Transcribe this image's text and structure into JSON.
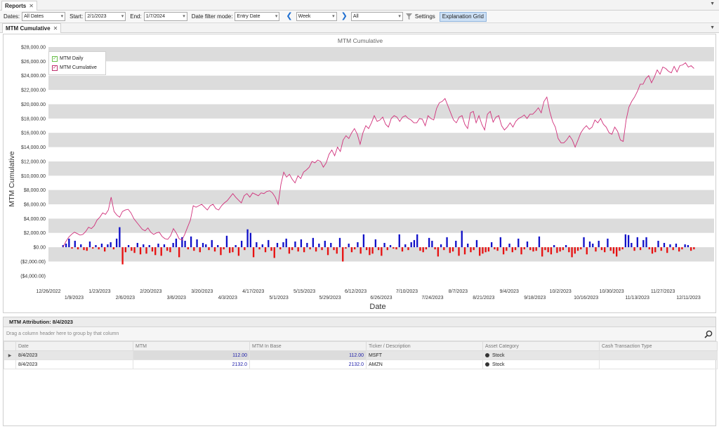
{
  "tabs": {
    "doc_tab": "Reports",
    "close": "✕",
    "sub_tab": "MTM Cumulative"
  },
  "toolbar": {
    "dates_label": "Dates:",
    "dates_value": "All Dates",
    "start_label": "Start:",
    "start_value": "2/1/2023",
    "end_label": "End:",
    "end_value": "1/7/2024",
    "filter_mode_label": "Date filter mode:",
    "filter_mode_value": "Entry Date",
    "period_value": "Week",
    "scope_value": "All",
    "settings_label": "Settings",
    "explanation_grid_label": "Explanation Grid"
  },
  "chart_data": {
    "type": "bar+line",
    "title": "MTM Cumulative",
    "xlabel": "Date",
    "ylabel": "MTM Cumulative",
    "ylim": [
      -5000,
      28000
    ],
    "y_ticks": [
      "$28,000.00",
      "$26,000.00",
      "$24,000.00",
      "$22,000.00",
      "$20,000.00",
      "$18,000.00",
      "$16,000.00",
      "$14,000.00",
      "$12,000.00",
      "$10,000.00",
      "$8,000.00",
      "$6,000.00",
      "$4,000.00",
      "$2,000.00",
      "$0.00",
      "($2,000.00)",
      "($4,000.00)"
    ],
    "x_ticks_upper": [
      "12/26/2022",
      "1/23/2023",
      "2/20/2023",
      "3/20/2023",
      "4/17/2023",
      "5/15/2023",
      "6/12/2023",
      "7/10/2023",
      "8/7/2023",
      "9/4/2023",
      "10/2/2023",
      "10/30/2023",
      "11/27/2023"
    ],
    "x_ticks_lower": [
      "1/9/2023",
      "2/6/2023",
      "3/6/2023",
      "4/3/2023",
      "5/1/2023",
      "5/29/2023",
      "6/26/2023",
      "7/24/2023",
      "8/21/2023",
      "9/18/2023",
      "10/16/2023",
      "11/13/2023",
      "12/11/2023"
    ],
    "x_range": [
      "12/26/2022",
      "12/25/2023"
    ],
    "legend_position": "top-left",
    "colors": {
      "daily_positive": "#1010c8",
      "daily_negative": "#e81010",
      "cumulative": "#d0307a"
    },
    "series": [
      {
        "name": "MTM Daily",
        "values": [
          300,
          500,
          1200,
          -200,
          900,
          -300,
          400,
          -400,
          -500,
          800,
          -200,
          300,
          -300,
          500,
          -600,
          400,
          700,
          -300,
          1200,
          2800,
          -2400,
          -700,
          300,
          -500,
          -800,
          600,
          -1000,
          400,
          -900,
          300,
          -600,
          -1100,
          500,
          -1200,
          400,
          -500,
          -700,
          600,
          1200,
          -1400,
          1400,
          900,
          -300,
          1500,
          -500,
          1100,
          -700,
          600,
          400,
          -400,
          1000,
          -600,
          300,
          -1100,
          -300,
          1600,
          -800,
          -700,
          300,
          -1200,
          900,
          -400,
          2500,
          2000,
          -1400,
          700,
          -300,
          400,
          -700,
          1000,
          -500,
          -1500,
          600,
          -300,
          700,
          1200,
          -900,
          -400,
          800,
          -600,
          1100,
          -700,
          600,
          -300,
          1300,
          -600,
          500,
          -400,
          900,
          -1100,
          600,
          -400,
          -900,
          1300,
          -2000,
          -200,
          500,
          -700,
          -300,
          700,
          -900,
          1800,
          -400,
          -1100,
          -900,
          1100,
          -400,
          -1200,
          600,
          -400,
          300,
          -200,
          -300,
          1800,
          -600,
          400,
          -400,
          700,
          1000,
          1800,
          -500,
          -700,
          -300,
          1300,
          900,
          -300,
          -1300,
          400,
          -400,
          1400,
          -800,
          -600,
          900,
          -1200,
          2300,
          -1000,
          500,
          -700,
          -400,
          1000,
          -1200,
          -900,
          -700,
          -600,
          700,
          -300,
          -500,
          1400,
          -1000,
          -500,
          500,
          -700,
          -400,
          1200,
          -1000,
          -300,
          800,
          -400,
          -600,
          -500,
          1500,
          -1300,
          -400,
          -700,
          -1000,
          300,
          -800,
          -600,
          -400,
          300,
          -700,
          -1400,
          -900,
          -500,
          -300,
          1400,
          -1000,
          800,
          500,
          -600,
          900,
          -400,
          -700,
          1200,
          -500,
          -900,
          -1300,
          -500,
          -300,
          1800,
          1700,
          600,
          -500,
          1400,
          -400,
          1000,
          1400,
          -300,
          -900,
          -700,
          900,
          -500,
          600,
          -800,
          400,
          -400,
          500,
          -600,
          -300,
          400,
          300,
          -500,
          -300
        ],
        "labels_note_free": true
      },
      {
        "name": "MTM Cumulative",
        "values": [
          0,
          800,
          1400,
          1800,
          2100,
          1900,
          1700,
          1800,
          2200,
          2800,
          2600,
          3000,
          3800,
          4200,
          4800,
          4600,
          5200,
          7000,
          5000,
          4500,
          4200,
          5000,
          5200,
          5300,
          4800,
          4000,
          3500,
          3000,
          2500,
          2300,
          2700,
          2100,
          1800,
          2000,
          2100,
          1500,
          1200,
          1100,
          1600,
          2600,
          2000,
          1200,
          1000,
          1800,
          2800,
          3800,
          5800,
          5600,
          5800,
          6000,
          5600,
          5200,
          5800,
          6000,
          5400,
          5200,
          5800,
          6200,
          6500,
          7000,
          7500,
          7000,
          6600,
          6200,
          7200,
          7500,
          7000,
          7600,
          7400,
          7200,
          7600,
          7500,
          7800,
          7900,
          7600,
          7000,
          6000,
          8800,
          10500,
          9800,
          10200,
          9500,
          9000,
          10000,
          9600,
          10500,
          10800,
          11200,
          12000,
          11800,
          12200,
          12000,
          11200,
          11800,
          13000,
          13600,
          12800,
          14000,
          13400,
          15000,
          15600,
          15200,
          16000,
          16600,
          15800,
          14400,
          16000,
          17000,
          16600,
          17400,
          18400,
          17600,
          17800,
          18200,
          17200,
          16800,
          18000,
          18400,
          18200,
          17600,
          18200,
          18400,
          18000,
          17800,
          17400,
          17400,
          18000,
          17900,
          17000,
          18400,
          18000,
          17800,
          19400,
          20200,
          20400,
          20800,
          19800,
          18800,
          17800,
          17400,
          18200,
          18400,
          17200,
          16600,
          18800,
          19000,
          17400,
          18400,
          17200,
          16400,
          18600,
          19000,
          17500,
          18200,
          18400,
          17000,
          16400,
          16800,
          17400,
          16800,
          17600,
          18000,
          18200,
          18500,
          18000,
          18600,
          18600,
          19000,
          19500,
          18800,
          20400,
          21000,
          19000,
          17600,
          16800,
          15200,
          14600,
          14600,
          15000,
          15600,
          15000,
          14000,
          15000,
          16000,
          16600,
          17000,
          16500,
          16800,
          17800,
          17400,
          18000,
          17200,
          16800,
          16000,
          15800,
          16800,
          16200,
          15000,
          14800,
          17800,
          19600,
          20400,
          21000,
          21800,
          22800,
          22800,
          23600,
          24000,
          23000,
          23800,
          24800,
          24200,
          25200,
          25000,
          24600,
          24400,
          25300,
          24500,
          25400,
          25500,
          25800,
          25200,
          25400,
          25000
        ]
      }
    ]
  },
  "attribution": {
    "title": "MTM Attribution: 8/4/2023",
    "group_hint": "Drag a column header here to group by that column",
    "columns": [
      "Date",
      "MTM",
      "MTM In Base",
      "Ticker / Description",
      "Asset Category",
      "Cash Transaction Type"
    ],
    "rows": [
      {
        "date": "8/4/2023",
        "mtm": "112.00",
        "mtm_base": "112.00",
        "ticker": "MSFT",
        "asset": "Stock",
        "cash_type": ""
      },
      {
        "date": "8/4/2023",
        "mtm": "2132.0",
        "mtm_base": "2132.0",
        "ticker": "AMZN",
        "asset": "Stock",
        "cash_type": ""
      }
    ]
  }
}
